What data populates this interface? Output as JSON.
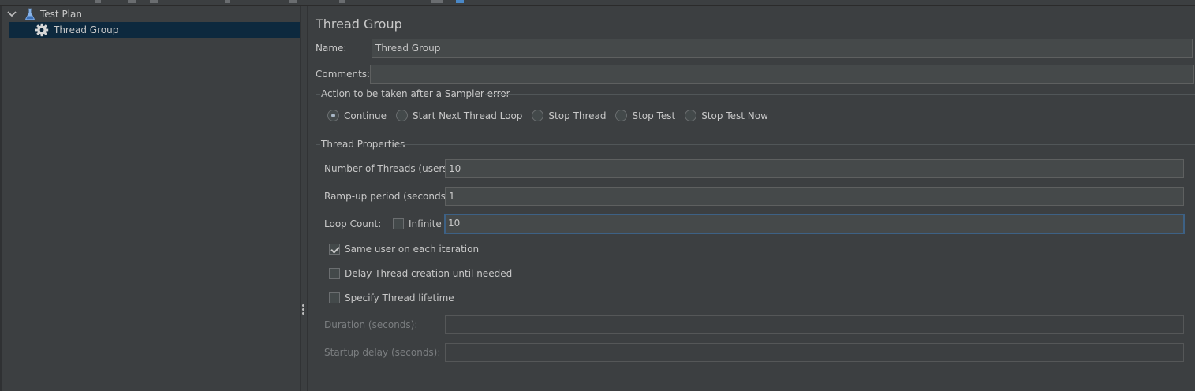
{
  "tree": {
    "items": [
      {
        "label": "Test Plan",
        "icon": "flask-icon",
        "expanded": true
      },
      {
        "label": "Thread Group",
        "icon": "gear-icon",
        "selected": true
      }
    ]
  },
  "panel": {
    "title": "Thread Group",
    "name_label": "Name:",
    "name_value": "Thread Group",
    "comments_label": "Comments:",
    "comments_value": "",
    "error_action": {
      "legend": "Action to be taken after a Sampler error",
      "options": [
        "Continue",
        "Start Next Thread Loop",
        "Stop Thread",
        "Stop Test",
        "Stop Test Now"
      ],
      "selected": "Continue"
    },
    "thread_props": {
      "legend": "Thread Properties",
      "threads_label": "Number of Threads (users):",
      "threads_value": "10",
      "rampup_label": "Ramp-up period (seconds):",
      "rampup_value": "1",
      "loop_label": "Loop Count:",
      "infinite_label": "Infinite",
      "infinite_checked": false,
      "loop_value": "10",
      "same_user_label": "Same user on each iteration",
      "same_user_checked": true,
      "delay_label": "Delay Thread creation until needed",
      "delay_checked": false,
      "lifetime_label": "Specify Thread lifetime",
      "lifetime_checked": false,
      "duration_label": "Duration (seconds):",
      "duration_value": "",
      "startup_label": "Startup delay (seconds):",
      "startup_value": ""
    }
  },
  "colors": {
    "background": "#3c3f41",
    "selection": "#0d293e",
    "focus_border": "#3d6185"
  }
}
